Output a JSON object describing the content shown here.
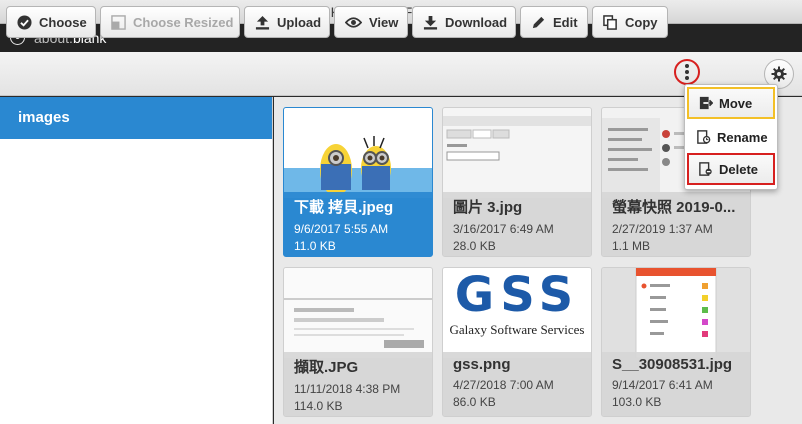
{
  "window": {
    "title": "CKFinder 3 - File Browser"
  },
  "address": {
    "scheme": "about:",
    "page": "blank"
  },
  "toolbar": {
    "choose": "Choose",
    "choose_resized": "Choose Resized",
    "upload": "Upload",
    "view": "View",
    "download": "Download",
    "edit": "Edit",
    "copy": "Copy"
  },
  "sidebar": {
    "folders": [
      {
        "label": "images",
        "selected": true
      }
    ]
  },
  "files": [
    {
      "name": "下載 拷貝.jpeg",
      "date": "9/6/2017 5:55 AM",
      "size": "11.0 KB",
      "selected": true
    },
    {
      "name": "圖片 3.jpg",
      "date": "3/16/2017 6:49 AM",
      "size": "28.0 KB",
      "selected": false
    },
    {
      "name": "螢幕快照 2019-0...",
      "date": "2/27/2019 1:37 AM",
      "size": "1.1 MB",
      "selected": false
    },
    {
      "name": "擷取.JPG",
      "date": "11/11/2018 4:38 PM",
      "size": "114.0 KB",
      "selected": false
    },
    {
      "name": "gss.png",
      "date": "4/27/2018 7:00 AM",
      "size": "86.0 KB",
      "selected": false
    },
    {
      "name": "S__30908531.jpg",
      "date": "9/14/2017 6:41 AM",
      "size": "103.0 KB",
      "selected": false
    }
  ],
  "thumb_text": {
    "gss_logo": "GSS",
    "gss_tagline": "Galaxy Software Services"
  },
  "menu": {
    "move": "Move",
    "rename": "Rename",
    "delete": "Delete"
  },
  "colors": {
    "accent": "#2a88d1",
    "highlight_red": "#d7201f",
    "highlight_yellow": "#f3c027"
  }
}
